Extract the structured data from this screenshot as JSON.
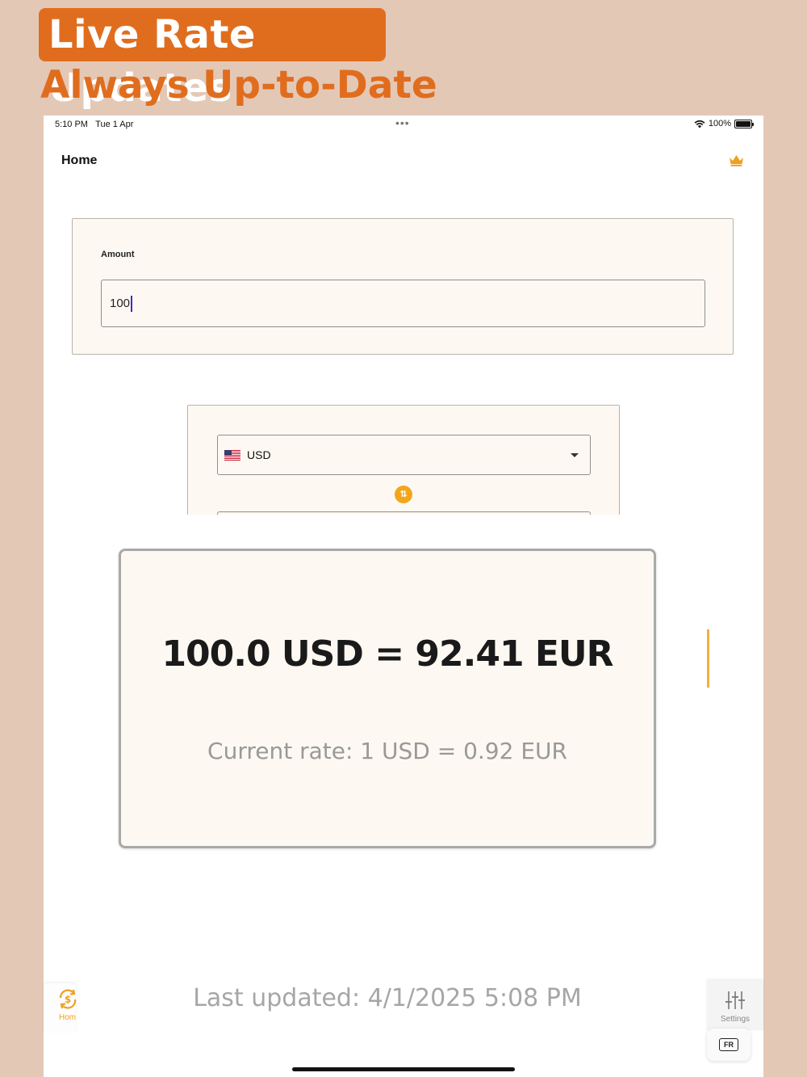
{
  "promo": {
    "headline": "Live Rate Updates",
    "subheadline": "Always Up-to-Date",
    "accent_color": "#e06d1e"
  },
  "status_bar": {
    "time": "5:10 PM",
    "date": "Tue 1 Apr",
    "battery": "100%"
  },
  "nav": {
    "title": "Home",
    "premium_icon": "crown-icon"
  },
  "amount": {
    "label": "Amount",
    "value": "100"
  },
  "converter": {
    "from_currency": "USD",
    "from_flag": "us-flag-icon",
    "swap_icon": "swap-arrows-icon"
  },
  "result": {
    "conversion": "100.0 USD = 92.41 EUR",
    "rate": "Current rate: 1 USD = 0.92 EUR"
  },
  "footer": {
    "last_updated": "Last updated: 4/1/2025 5:08 PM",
    "home_tab_label": "Hom",
    "settings_tab_label": "Settings",
    "language_button": "FR"
  }
}
